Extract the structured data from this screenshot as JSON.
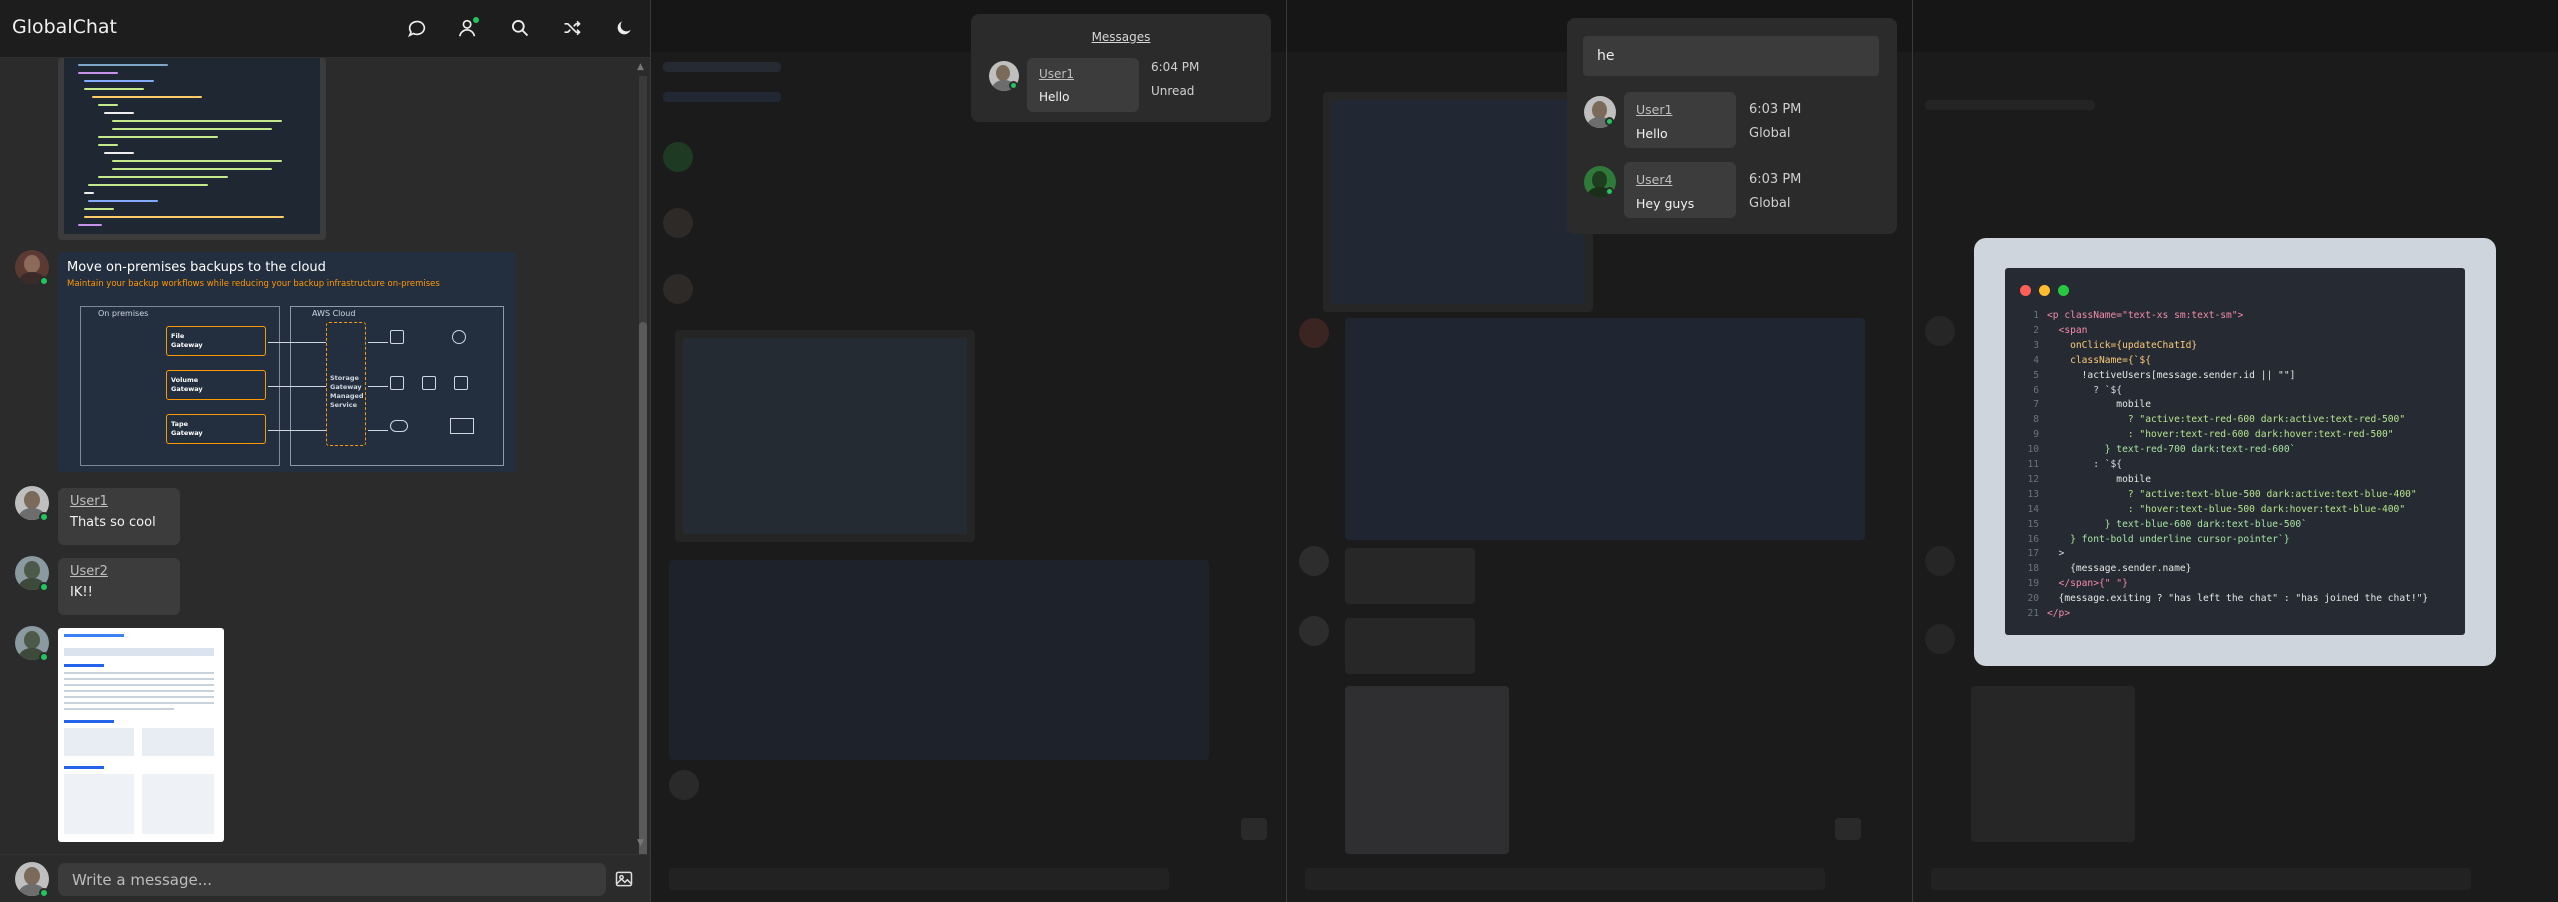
{
  "pane1": {
    "app_title": "GlobalChat",
    "input_placeholder": "Write a message...",
    "aws_card": {
      "title": "Move on-premises backups to the cloud",
      "subtitle": "Maintain your backup workflows while reducing your backup infrastructure on-premises",
      "on_premises": "On premises",
      "aws_cloud": "AWS Cloud",
      "file_gateway": "File\nGateway",
      "volume_gateway": "Volume\nGateway",
      "tape_gateway": "Tape\nGateway",
      "managed_service": "Storage\nGateway\nManaged\nService"
    },
    "messages": [
      {
        "user": "User1",
        "text": "Thats so cool"
      },
      {
        "user": "User2",
        "text": "IK!!"
      }
    ]
  },
  "pane2": {
    "messages_popup": {
      "header": "Messages",
      "user": "User1",
      "text": "Hello",
      "time": "6:04 PM",
      "status": "Unread"
    }
  },
  "pane3": {
    "search_popup": {
      "query": "he",
      "results": [
        {
          "user": "User1",
          "text": "Hello",
          "time": "6:03 PM",
          "channel": "Global"
        },
        {
          "user": "User4",
          "text": "Hey guys",
          "time": "6:03 PM",
          "channel": "Global"
        }
      ]
    }
  },
  "pane4": {
    "code_lines": [
      {
        "n": "1",
        "t": "<p className=\"text-xs sm:text-sm\">"
      },
      {
        "n": "2",
        "t": "  <span"
      },
      {
        "n": "3",
        "t": "    onClick={updateChatId}"
      },
      {
        "n": "4",
        "t": "    className={`${"
      },
      {
        "n": "5",
        "t": "      !activeUsers[message.sender.id || \"\"]"
      },
      {
        "n": "6",
        "t": "        ? `${"
      },
      {
        "n": "7",
        "t": "            mobile"
      },
      {
        "n": "8",
        "t": "              ? \"active:text-red-600 dark:active:text-red-500\""
      },
      {
        "n": "9",
        "t": "              : \"hover:text-red-600 dark:hover:text-red-500\""
      },
      {
        "n": "10",
        "t": "          } text-red-700 dark:text-red-600`"
      },
      {
        "n": "11",
        "t": "        : `${"
      },
      {
        "n": "12",
        "t": "            mobile"
      },
      {
        "n": "13",
        "t": "              ? \"active:text-blue-500 dark:active:text-blue-400\""
      },
      {
        "n": "14",
        "t": "              : \"hover:text-blue-500 dark:hover:text-blue-400\""
      },
      {
        "n": "15",
        "t": "          } text-blue-600 dark:text-blue-500`"
      },
      {
        "n": "16",
        "t": "    } font-bold underline cursor-pointer`}"
      },
      {
        "n": "17",
        "t": "  >"
      },
      {
        "n": "18",
        "t": "    {message.sender.name}"
      },
      {
        "n": "19",
        "t": "  </span>{\" \"}"
      },
      {
        "n": "20",
        "t": "  {message.exiting ? \"has left the chat\" : \"has joined the chat!\"}"
      },
      {
        "n": "21",
        "t": "</p>"
      }
    ]
  },
  "icons": [
    "chat-icon",
    "user-icon",
    "search-icon",
    "shuffle-icon",
    "moon-icon",
    "image-icon",
    "close-dot-icon",
    "minimize-dot-icon",
    "maximize-dot-icon"
  ],
  "colors": {
    "online": "#22c55e",
    "aws_orange": "#ff9900",
    "mac_red": "#ff5f57",
    "mac_yellow": "#febc2e",
    "mac_green": "#28c840"
  }
}
